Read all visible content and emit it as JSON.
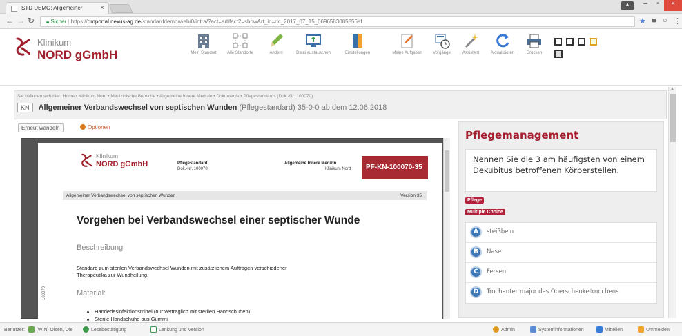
{
  "browser": {
    "tab_title": "STD DEMO: Allgemeiner",
    "tab_close": "×",
    "url_secure_label": "Sicher",
    "url_scheme": "https://",
    "url_host": "qmportal.nexus-ag.de",
    "url_path": "/standarddemo/web/0/intra/?act=artifact2=showArt_id=dc_2017_07_15_0696583085856af",
    "window_min": "–",
    "window_max": "▫",
    "window_close": "×"
  },
  "app": {
    "logo_line1": "Klinikum",
    "logo_line2": "NORD gGmbH",
    "toolbar": [
      {
        "label": "Mein Standort",
        "icon": "building-icon"
      },
      {
        "label": "Alle Standorte",
        "icon": "sitemap-icon"
      },
      {
        "label": "Ändern",
        "icon": "pencil-icon"
      },
      {
        "label": "Datei austauschen",
        "icon": "monitor-upload-icon"
      },
      {
        "label": "Einstellungen",
        "icon": "settings-book-icon"
      },
      {
        "label": "Meine Aufgaben",
        "icon": "clipboard-edit-icon"
      },
      {
        "label": "Vorgänge",
        "icon": "process-clock-icon"
      },
      {
        "label": "Assistent",
        "icon": "magic-wand-icon"
      },
      {
        "label": "Aktualisieren",
        "icon": "refresh-icon"
      },
      {
        "label": "Drucken",
        "icon": "printer-icon"
      }
    ]
  },
  "breadcrumb": {
    "text": "Sie befinden sich hier:  Home • Klinikum Nord • Medizinische Bereiche • Allgemeine Innere Medizin • Dokumente • Pflegestandards (Dok.-Nr: 100070)",
    "kn": "KN",
    "title": "Allgemeiner Verbandswechsel von septischen Wunden",
    "subtitle": "(Pflegestandard)  35-0-0 ab dem 12.06.2018"
  },
  "viewer": {
    "reload_label": "Erneut wandeln",
    "options_label": "Optionen",
    "pdf": {
      "logo_line1": "Klinikum",
      "logo_line2": "NORD gGmbH",
      "doctype": "Pflegestandard",
      "docnr": "Dok.-Nr. 100070",
      "dept1": "Allgemeine Innere Medizin",
      "dept2": "Klinikum Nord",
      "badge": "PF-KN-100070-35",
      "bar_left": "Allgemeiner Verbandswechsel von septischen Wunden",
      "bar_right": "Version 35",
      "heading": "Vorgehen bei Verbandswechsel einer septischer Wunde",
      "section1": "Beschreibung",
      "desc_line1": "Standard zum sterilen Verbandswechsel Wunden mit zusätzlichem Auftragen verschiedener",
      "desc_line2": "Therapeutika zur Wundheilung.",
      "section2": "Material:",
      "item1": "Händedesinfektionsmittel (nur verträglich mit sterilen Handschuhen)",
      "item2": "Sterile Handschuhe aus Gummi",
      "side_id": "100070"
    }
  },
  "panel": {
    "title": "Pflegemanagement",
    "question": "Nennen Sie die 3 am häufigsten von einem Dekubitus betroffenen Körperstellen.",
    "tag1": "Pflege",
    "tag2": "Multiple Choice",
    "answers": [
      {
        "letter": "A",
        "text": "steißbein"
      },
      {
        "letter": "B",
        "text": "Nase"
      },
      {
        "letter": "C",
        "text": "Fersen"
      },
      {
        "letter": "D",
        "text": "Trochanter major des Oberschenkelknochens"
      }
    ]
  },
  "footer": {
    "user_label": "Benutzer:",
    "user_name": "[WIN] Olsen, Ole",
    "read_confirm": "Lesebestätigung",
    "guidance": "Lenkung und Version",
    "admin": "Admin",
    "sysinfo": "Systeminformationen",
    "share": "Mitteilen",
    "logout": "Ummelden"
  }
}
